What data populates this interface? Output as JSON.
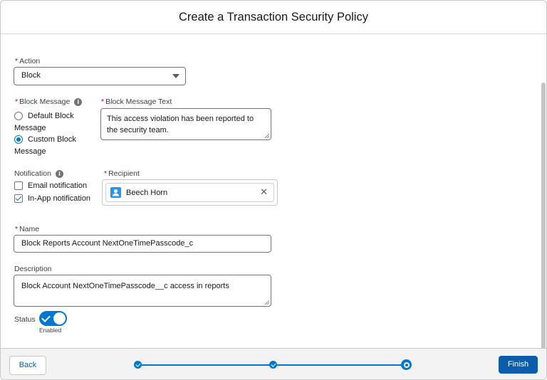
{
  "modal": {
    "title": "Create a Transaction Security Policy"
  },
  "form": {
    "required_marker": "*",
    "action": {
      "label": "Action",
      "value": "Block"
    },
    "block_message": {
      "label": "Block Message",
      "info_icon": "i",
      "options": [
        {
          "line1": "Default Block",
          "line2": "Message",
          "selected": false
        },
        {
          "line1": "Custom Block",
          "line2": "Message",
          "selected": true
        }
      ]
    },
    "block_message_text": {
      "label": "Block Message Text",
      "line1": "This access violation has been reported to",
      "line2": "the security team."
    },
    "notification": {
      "label": "Notification",
      "info_icon": "i",
      "options": [
        {
          "label": "Email notification",
          "checked": false
        },
        {
          "label": "In-App notification",
          "checked": true
        }
      ]
    },
    "recipient": {
      "label": "Recipient",
      "name": "Beech Horn",
      "remove_icon": "✕",
      "avatar_color": "#1b96ff"
    },
    "name": {
      "label": "Name",
      "value": "Block Reports Account NextOneTimePasscode_c"
    },
    "description": {
      "label": "Description",
      "value": "Block Account NextOneTimePasscode__c access in reports"
    },
    "status": {
      "label": "Status",
      "toggle_on": true,
      "toggle_label": "Enabled"
    }
  },
  "footer": {
    "back_label": "Back",
    "finish_label": "Finish",
    "steps": [
      {
        "state": "complete"
      },
      {
        "state": "complete"
      },
      {
        "state": "current"
      }
    ]
  },
  "colors": {
    "brand": "#0176d3",
    "brand_dark": "#0b5cab",
    "required": "#ba0517"
  }
}
